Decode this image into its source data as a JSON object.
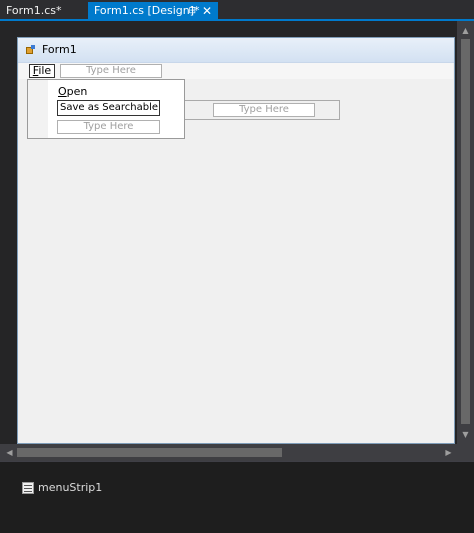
{
  "tabs": [
    {
      "label": "Form1.cs*",
      "active": false
    },
    {
      "label": "Form1.cs [Design]*",
      "active": true
    }
  ],
  "tab_icons": {
    "pin": "pin-icon",
    "close": "close-icon"
  },
  "form": {
    "title": "Form1",
    "menu": {
      "file_prefix": "",
      "file_mnemonic": "F",
      "file_rest": "ile",
      "type_here": "Type Here"
    },
    "dropdown": {
      "open_mnemonic": "O",
      "open_rest": "pen",
      "edit_value": "Save as Searchable &P",
      "type_here": "Type Here"
    },
    "body_type_here": "Type Here"
  },
  "tray": {
    "items": [
      {
        "label": "menuStrip1",
        "icon": "menustrip-icon"
      }
    ]
  },
  "colors": {
    "accent": "#007acc",
    "background": "#1e1e1e",
    "form": "#f0f0f0"
  }
}
